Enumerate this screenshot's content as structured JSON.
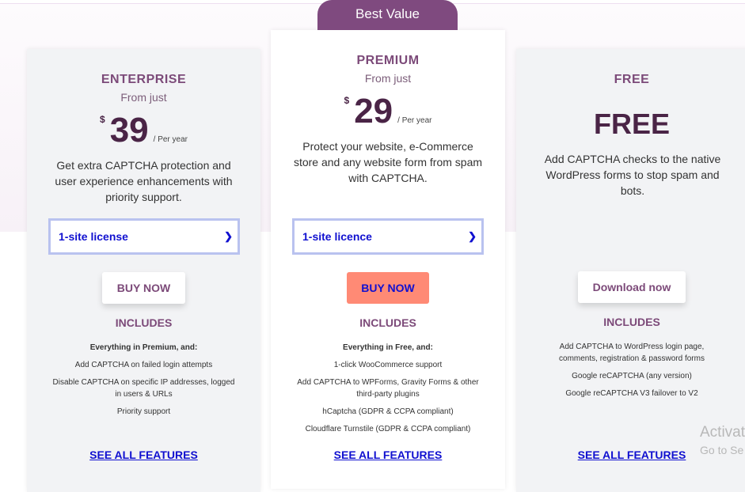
{
  "badge": "Best Value",
  "plans": [
    {
      "tier": "ENTERPRISE",
      "from": "From just",
      "currency": "$",
      "price": "39",
      "period": "/ Per year",
      "description": "Get extra CAPTCHA protection and user experience enhancements with priority support.",
      "license": "1-site license",
      "button": "BUY NOW",
      "includes": "INCLUDES",
      "features": [
        "Everything in Premium, and:",
        "Add CAPTCHA on failed login attempts",
        "Disable CAPTCHA on specific IP addresses, logged in users & URLs",
        "Priority support"
      ],
      "see_all": "SEE ALL FEATURES"
    },
    {
      "tier": "PREMIUM",
      "from": "From just",
      "currency": "$",
      "price": "29",
      "period": "/ Per year",
      "description": "Protect your website, e-Commerce store and any website form from spam with CAPTCHA.",
      "license": "1-site licence",
      "button": "BUY NOW",
      "includes": "INCLUDES",
      "features": [
        "Everything in Free, and:",
        "1-click WooCommerce support",
        "Add CAPTCHA to WPForms, Gravity Forms & other third-party plugins",
        "hCaptcha (GDPR & CCPA compliant)",
        "Cloudflare Turnstile (GDPR & CCPA compliant)"
      ],
      "see_all": "SEE ALL FEATURES"
    },
    {
      "tier": "FREE",
      "price": "FREE",
      "description": "Add CAPTCHA checks to the native WordPress forms to stop spam and bots.",
      "button": "Download now",
      "includes": "INCLUDES",
      "features": [
        "Add CAPTCHA to WordPress login page, comments, registration & password forms",
        "Google reCAPTCHA (any version)",
        "Google reCAPTCHA V3 failover to V2"
      ],
      "see_all": "SEE ALL FEATURES"
    }
  ],
  "watermark": {
    "line1": "Activat",
    "line2": "Go to Se"
  },
  "colors": {
    "brand": "#7f4a7f",
    "cta": "#ff8a75",
    "link": "#1010d0"
  }
}
